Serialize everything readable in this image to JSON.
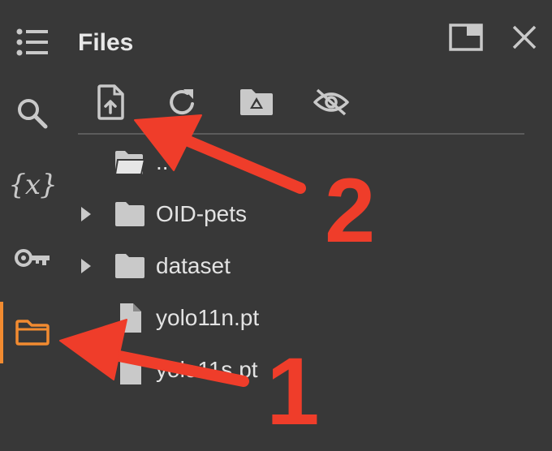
{
  "panel": {
    "title": "Files"
  },
  "rail": {
    "items": [
      {
        "icon": "table-of-contents-icon"
      },
      {
        "icon": "search-icon"
      },
      {
        "icon": "variables-icon",
        "glyph": "{x}"
      },
      {
        "icon": "key-icon"
      },
      {
        "icon": "folder-icon",
        "active": true
      }
    ]
  },
  "toolbar": {
    "items": [
      {
        "icon": "upload-file-icon"
      },
      {
        "icon": "refresh-icon"
      },
      {
        "icon": "mount-drive-icon"
      },
      {
        "icon": "hide-icon"
      }
    ]
  },
  "files": [
    {
      "name": "..",
      "type": "parent-folder"
    },
    {
      "name": "OID-pets",
      "type": "folder"
    },
    {
      "name": "dataset",
      "type": "folder"
    },
    {
      "name": "yolo11n.pt",
      "type": "file"
    },
    {
      "name": "yolo11s.pt",
      "type": "file"
    }
  ],
  "annotations": {
    "label_1": "1",
    "label_2": "2",
    "color": "#ef3d2a"
  },
  "colors": {
    "background": "#383838",
    "accent": "#f28b30",
    "text": "#e3e3e3",
    "icon": "#c9c9c9"
  }
}
